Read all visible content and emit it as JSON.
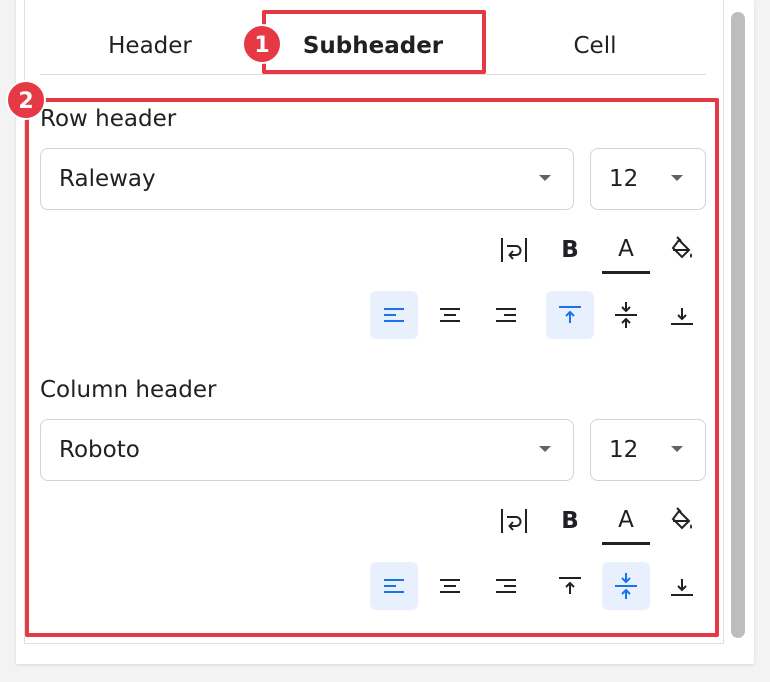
{
  "tabs": [
    {
      "label": "Header",
      "active": false
    },
    {
      "label": "Subheader",
      "active": true
    },
    {
      "label": "Cell",
      "active": false
    }
  ],
  "sections": [
    {
      "title": "Row header",
      "font": "Raleway",
      "size": "12",
      "horizontal_alignment": "left",
      "vertical_alignment": "top"
    },
    {
      "title": "Column header",
      "font": "Roboto",
      "size": "12",
      "horizontal_alignment": "left",
      "vertical_alignment": "middle"
    }
  ],
  "glyphs": {
    "bold": "B",
    "text_color": "A"
  },
  "annotations": [
    {
      "label": "1"
    },
    {
      "label": "2"
    }
  ],
  "colors": {
    "highlight": "#e53945",
    "selected_bg": "#e8f0fe",
    "selected_icon": "#1a73e8"
  },
  "icons": [
    "text-wrap-icon",
    "bold-icon",
    "text-color-icon",
    "fill-color-icon",
    "align-left-icon",
    "align-center-icon",
    "align-right-icon",
    "align-top-icon",
    "align-middle-icon",
    "align-bottom-icon"
  ]
}
